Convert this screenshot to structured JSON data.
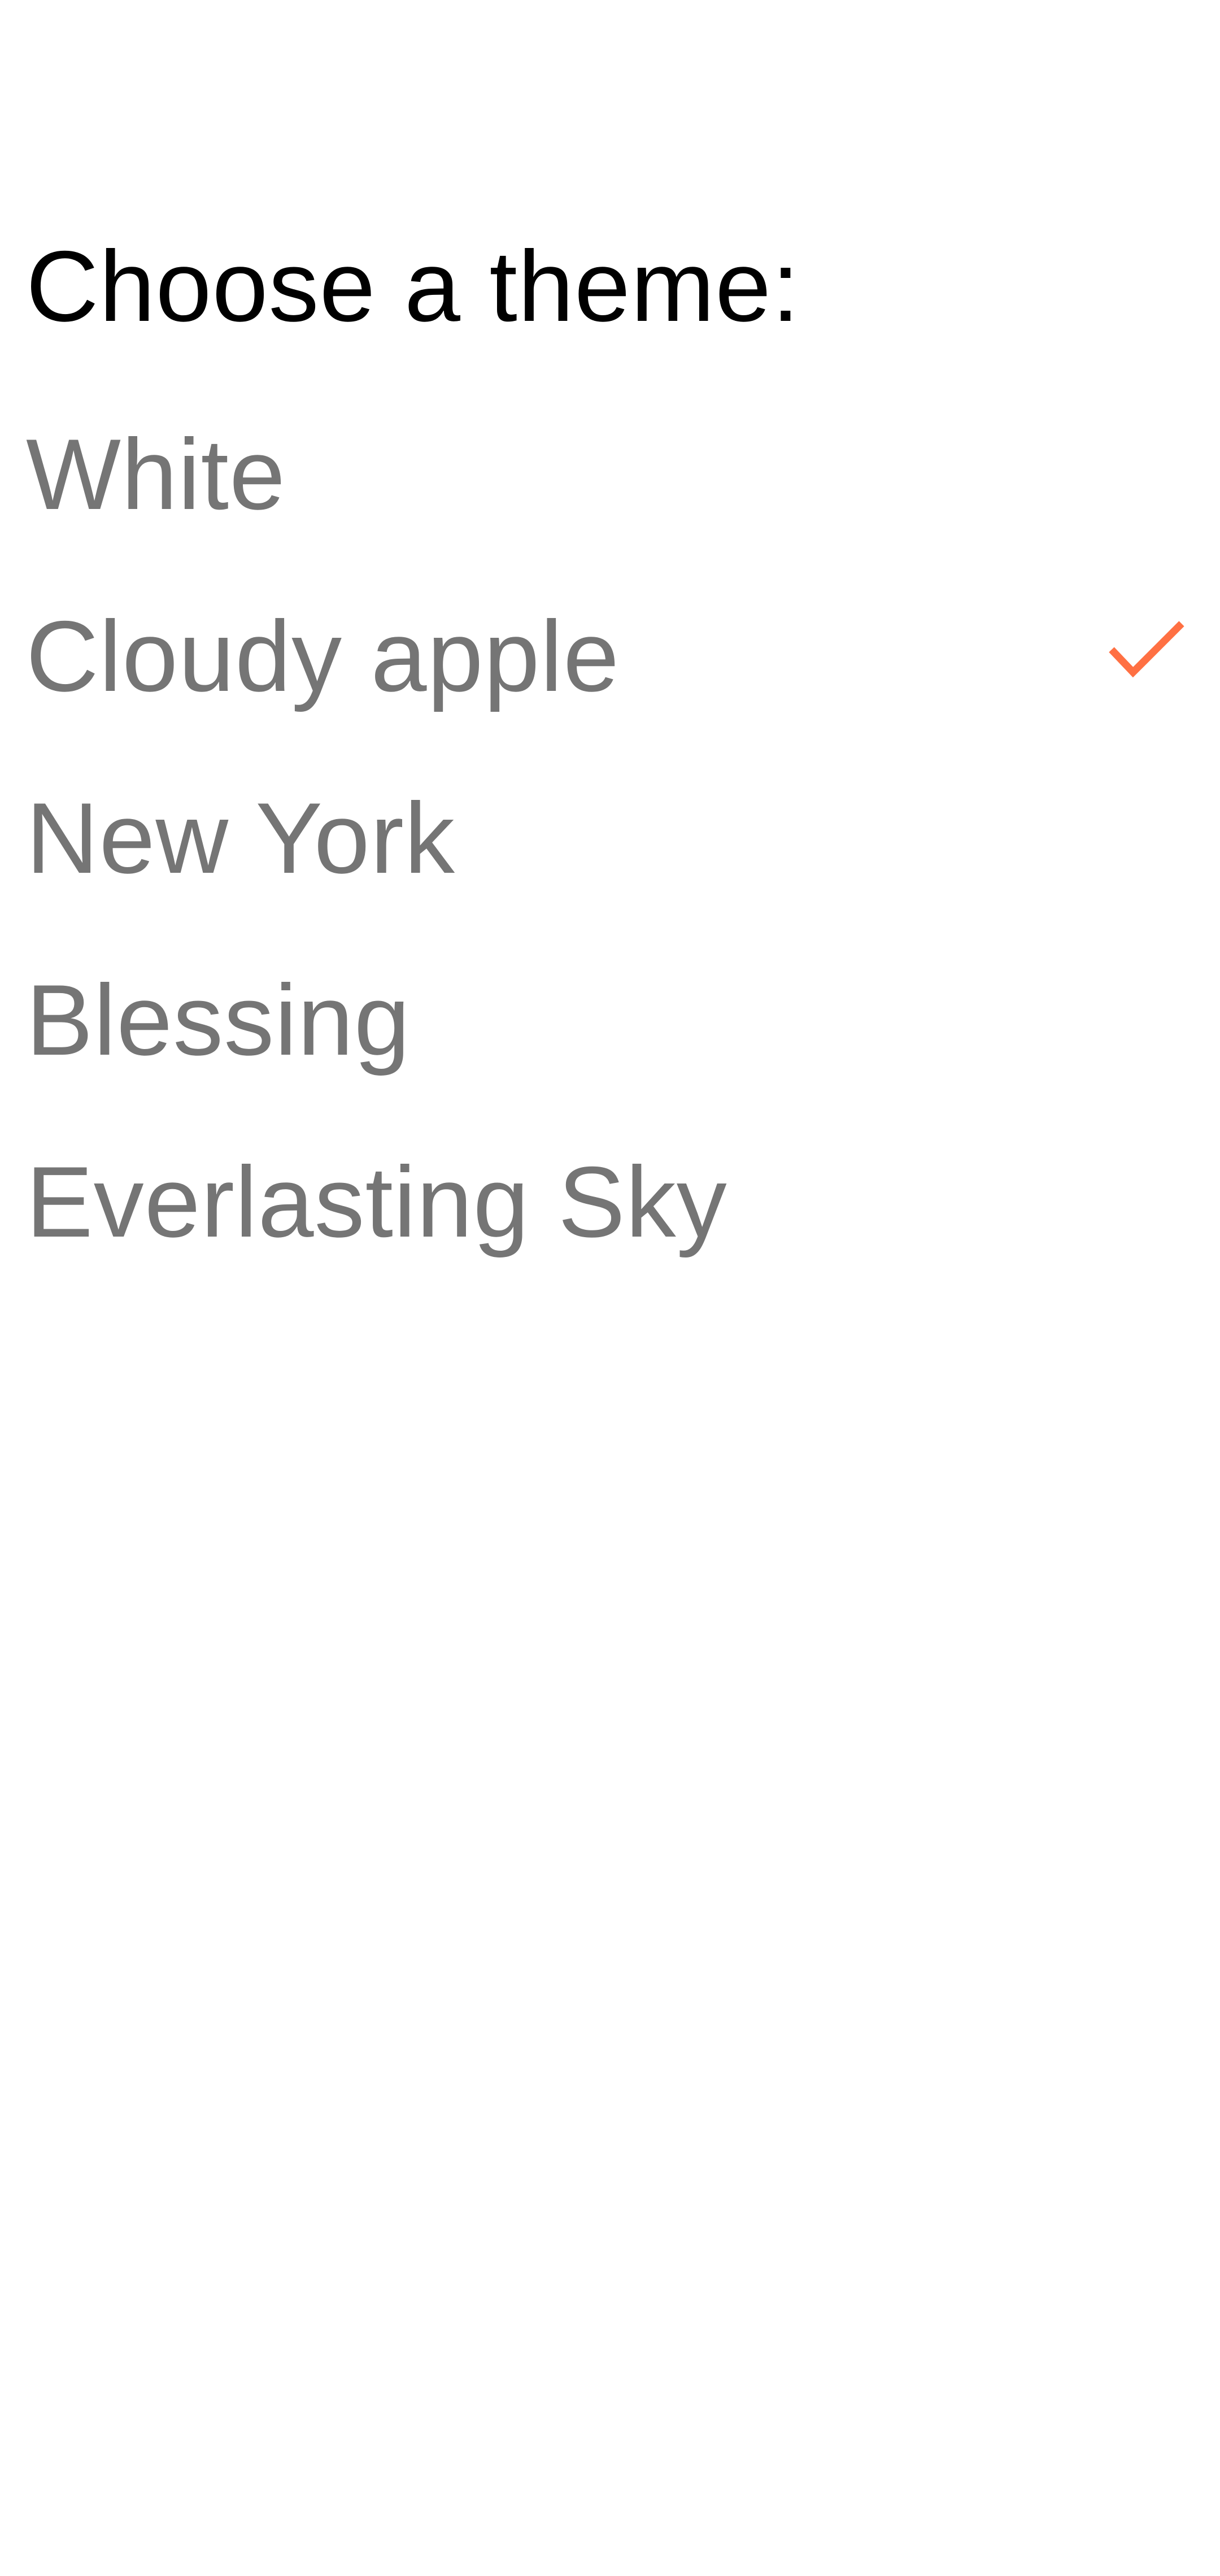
{
  "screen": {
    "title": "Choose a theme:"
  },
  "theme_list": {
    "items": [
      {
        "label": "White",
        "selected": false
      },
      {
        "label": "Cloudy apple",
        "selected": true
      },
      {
        "label": "New York",
        "selected": false
      },
      {
        "label": "Blessing",
        "selected": false
      },
      {
        "label": "Everlasting Sky",
        "selected": false
      }
    ],
    "check_icon": "checkmark-icon"
  },
  "colors": {
    "background": "#ffffff",
    "title_text": "#000000",
    "item_text": "#757575",
    "accent": "#FF7043"
  }
}
